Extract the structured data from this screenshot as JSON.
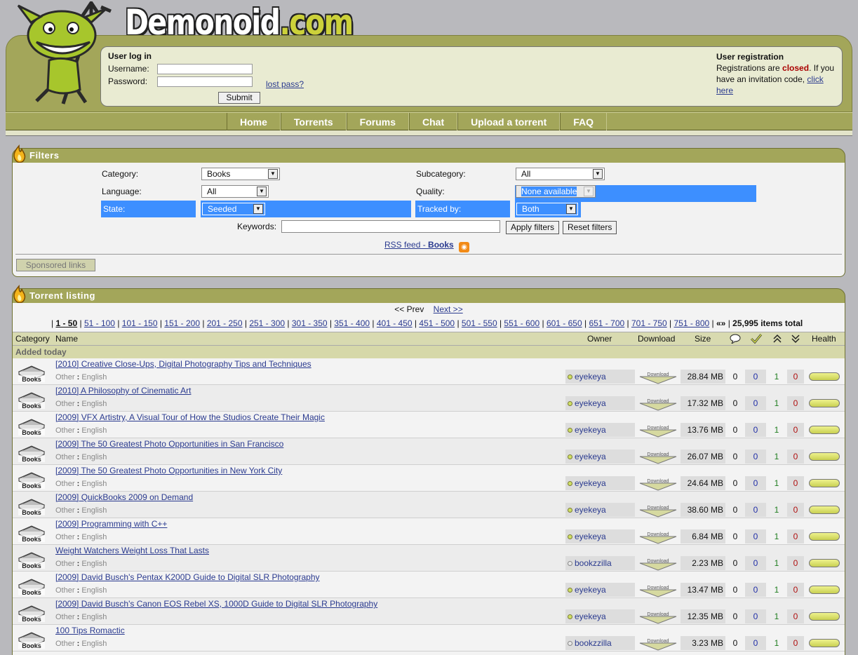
{
  "brand": {
    "name_white": "Demonoid",
    "name_yellow": ".com"
  },
  "login": {
    "title": "User log in",
    "username_label": "Username:",
    "password_label": "Password:",
    "submit_label": "Submit",
    "lost_pass": "lost pass?"
  },
  "registration": {
    "title": "User registration",
    "text_before": "Registrations are ",
    "status": "closed",
    "text_after": ". If you have an invitation code, ",
    "link": "click here"
  },
  "nav": [
    "Home",
    "Torrents",
    "Forums",
    "Chat",
    "Upload a torrent",
    "FAQ"
  ],
  "filters": {
    "title": "Filters",
    "category_label": "Category:",
    "category_value": "Books",
    "subcategory_label": "Subcategory:",
    "subcategory_value": "All",
    "language_label": "Language:",
    "language_value": "All",
    "quality_label": "Quality:",
    "quality_value": "None available",
    "state_label": "State:",
    "state_value": "Seeded",
    "tracked_label": "Tracked by:",
    "tracked_value": "Both",
    "keywords_label": "Keywords:",
    "apply": "Apply filters",
    "reset": "Reset filters",
    "rss_prefix": "RSS feed - ",
    "rss_category": "Books",
    "sponsored": "Sponsored links"
  },
  "listing": {
    "title": "Torrent listing",
    "prev": "<< Prev",
    "next": "Next >>",
    "pages": [
      "1 - 50",
      "51 - 100",
      "101 - 150",
      "151 - 200",
      "201 - 250",
      "251 - 300",
      "301 - 350",
      "351 - 400",
      "401 - 450",
      "451 - 500",
      "501 - 550",
      "551 - 600",
      "601 - 650",
      "651 - 700",
      "701 - 750",
      "751 - 800"
    ],
    "more": "«»",
    "total": "25,995 items total",
    "columns": {
      "category": "Category",
      "name": "Name",
      "owner": "Owner",
      "download": "Download",
      "size": "Size",
      "health": "Health"
    },
    "group": "Added today",
    "category_icon_label": "Books",
    "download_label": "Download",
    "rows": [
      {
        "title": "[2010] Creative Close-Ups, Digital Photography Tips and Techniques",
        "sub1": "Other",
        "sub2": "English",
        "owner": "eyekeya",
        "size": "28.84 MB",
        "comments": "0",
        "completed": "0",
        "seeders": "1",
        "leechers": "0"
      },
      {
        "title": "[2010] A Philosophy of Cinematic Art",
        "sub1": "Other",
        "sub2": "English",
        "owner": "eyekeya",
        "size": "17.32 MB",
        "comments": "0",
        "completed": "0",
        "seeders": "1",
        "leechers": "0"
      },
      {
        "title": "[2009] VFX Artistry, A Visual Tour of How the Studios Create Their Magic",
        "sub1": "Other",
        "sub2": "English",
        "owner": "eyekeya",
        "size": "13.76 MB",
        "comments": "0",
        "completed": "0",
        "seeders": "1",
        "leechers": "0"
      },
      {
        "title": "[2009] The 50 Greatest Photo Opportunities in San Francisco",
        "sub1": "Other",
        "sub2": "English",
        "owner": "eyekeya",
        "size": "26.07 MB",
        "comments": "0",
        "completed": "0",
        "seeders": "1",
        "leechers": "0"
      },
      {
        "title": "[2009] The 50 Greatest Photo Opportunities in New York City",
        "sub1": "Other",
        "sub2": "English",
        "owner": "eyekeya",
        "size": "24.64 MB",
        "comments": "0",
        "completed": "0",
        "seeders": "1",
        "leechers": "0"
      },
      {
        "title": "[2009] QuickBooks 2009 on Demand",
        "sub1": "Other",
        "sub2": "English",
        "owner": "eyekeya",
        "size": "38.60 MB",
        "comments": "0",
        "completed": "0",
        "seeders": "1",
        "leechers": "0"
      },
      {
        "title": "[2009] Programming with C++",
        "sub1": "Other",
        "sub2": "English",
        "owner": "eyekeya",
        "size": "6.84 MB",
        "comments": "0",
        "completed": "0",
        "seeders": "1",
        "leechers": "0"
      },
      {
        "title": "Weight Watchers Weight Loss That Lasts",
        "sub1": "Other",
        "sub2": "English",
        "owner": "bookzzilla",
        "size": "2.23 MB",
        "comments": "0",
        "completed": "0",
        "seeders": "1",
        "leechers": "0"
      },
      {
        "title": "[2009] David Busch's Pentax K200D Guide to Digital SLR Photography",
        "sub1": "Other",
        "sub2": "English",
        "owner": "eyekeya",
        "size": "13.47 MB",
        "comments": "0",
        "completed": "0",
        "seeders": "1",
        "leechers": "0"
      },
      {
        "title": "[2009] David Busch's Canon EOS Rebel XS, 1000D Guide to Digital SLR Photography",
        "sub1": "Other",
        "sub2": "English",
        "owner": "eyekeya",
        "size": "12.35 MB",
        "comments": "0",
        "completed": "0",
        "seeders": "1",
        "leechers": "0"
      },
      {
        "title": "100 Tips Romactic",
        "sub1": "Other",
        "sub2": "English",
        "owner": "bookzzilla",
        "size": "3.23 MB",
        "comments": "0",
        "completed": "0",
        "seeders": "1",
        "leechers": "0"
      }
    ]
  },
  "colors": {
    "olive": "#a3a65a",
    "link": "#2a3a8f",
    "highlight": "#3d8fff",
    "closed": "#aa0000"
  }
}
